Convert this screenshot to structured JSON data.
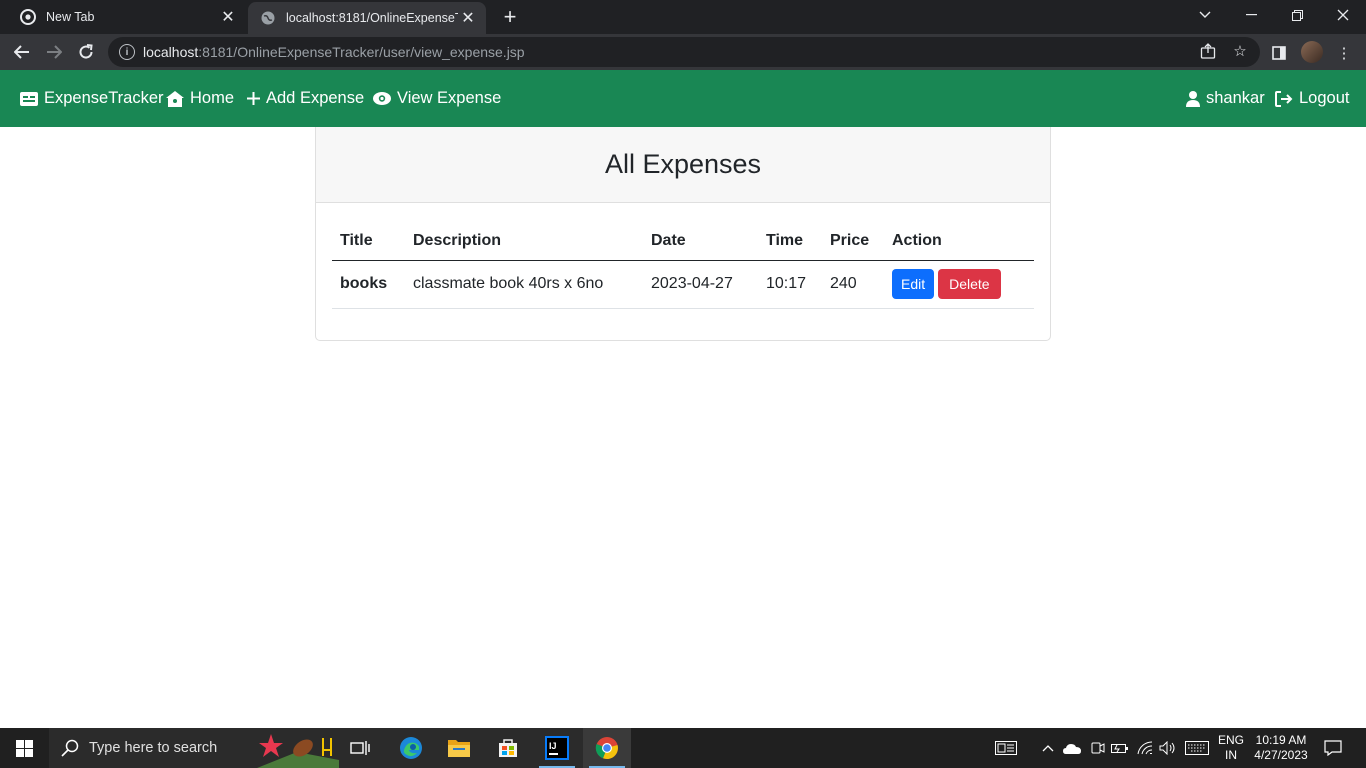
{
  "browser": {
    "tabs": [
      {
        "title": "New Tab",
        "favicon": "chrome-icon",
        "active": false
      },
      {
        "title": "localhost:8181/OnlineExpenseTra",
        "favicon": "globe-icon",
        "active": true
      }
    ],
    "url_host": "localhost",
    "url_path": ":8181/OnlineExpenseTracker/user/view_expense.jsp"
  },
  "navbar": {
    "brand": "ExpenseTracker",
    "home": "Home",
    "add_expense": "Add Expense",
    "view_expense": "View Expense",
    "user": "shankar",
    "logout": "Logout",
    "color": "#198754"
  },
  "card": {
    "title": "All Expenses",
    "columns": [
      "Title",
      "Description",
      "Date",
      "Time",
      "Price",
      "Action"
    ],
    "rows": [
      {
        "title": "books",
        "description": "classmate book 40rs x 6no",
        "date": "2023-04-27",
        "time": "10:17",
        "price": "240",
        "edit_label": "Edit",
        "delete_label": "Delete"
      }
    ]
  },
  "taskbar": {
    "search_placeholder": "Type here to search",
    "lang_top": "ENG",
    "lang_bottom": "IN",
    "time": "10:19 AM",
    "date": "4/27/2023"
  }
}
